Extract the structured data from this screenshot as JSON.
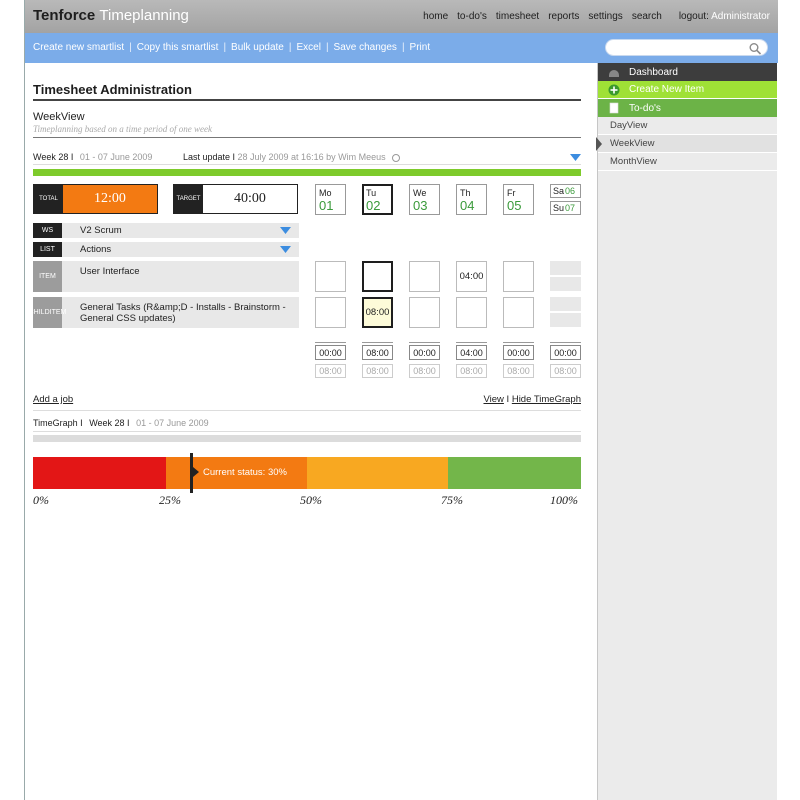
{
  "header": {
    "logo_part1": "Tenforce",
    "logo_part2": "Timeplanning",
    "nav": [
      "home",
      "to-do's",
      "timesheet",
      "reports",
      "settings",
      "search"
    ],
    "logout_label": "logout:",
    "user": "Administrator"
  },
  "toolbar": {
    "actions": [
      "Create new smartlist",
      "Copy this smartlist",
      "Bulk update",
      "Excel",
      "Save changes",
      "Print"
    ],
    "separator": "|",
    "search_placeholder": ""
  },
  "sidebar": {
    "dashboard": "Dashboard",
    "create_new_item": "Create New Item",
    "todos": "To-do's",
    "views": [
      "DayView",
      "WeekView",
      "MonthView"
    ],
    "active_view": "WeekView"
  },
  "page": {
    "title": "Timesheet Administration",
    "view_title": "WeekView",
    "view_subtitle": "Timeplanning based on a time period of one week",
    "week_label": "Week 28 I",
    "week_range": "01 - 07 June 2009",
    "last_update_label": "Last update I",
    "last_update_value": "28 July 2009 at 16:16 by Wim Meeus"
  },
  "totals": {
    "total_label": "TOTAL",
    "total_value": "12:00",
    "target_label": "TARGET",
    "target_value": "40:00"
  },
  "days": [
    {
      "name": "Mo",
      "date": "01"
    },
    {
      "name": "Tu",
      "date": "02"
    },
    {
      "name": "We",
      "date": "03"
    },
    {
      "name": "Th",
      "date": "04"
    },
    {
      "name": "Fr",
      "date": "05"
    }
  ],
  "weekend": [
    {
      "name": "Sa",
      "date": "06"
    },
    {
      "name": "Su",
      "date": "07"
    }
  ],
  "selectors": {
    "ws_tag": "WS",
    "ws_value": "V2 Scrum",
    "list_tag": "LIST",
    "list_value": "Actions"
  },
  "item": {
    "tag": "ITEM",
    "name": "User Interface",
    "hours": [
      "",
      "",
      "",
      "04:00",
      ""
    ]
  },
  "child_item": {
    "tag_line1": "CHILD",
    "tag_line2": "ITEM",
    "name": "General Tasks (R&amp;D - Installs - Brainstorm - General CSS updates)",
    "hours": [
      "",
      "08:00",
      "",
      "",
      ""
    ]
  },
  "summary": {
    "totals": [
      "00:00",
      "08:00",
      "00:00",
      "04:00",
      "00:00",
      "00:00"
    ],
    "targets": [
      "08:00",
      "08:00",
      "08:00",
      "08:00",
      "08:00",
      "08:00"
    ]
  },
  "actions": {
    "add_job": "Add a job",
    "view_label": "View",
    "separator": "I",
    "hide_timegraph": "Hide TimeGraph"
  },
  "timegraph": {
    "label": "TimeGraph I",
    "week": "Week 28 I",
    "range": "01 - 07 June 2009",
    "status_label": "Current status: 30%",
    "current_status_pct": 30,
    "ticks": [
      "0%",
      "25%",
      "50%",
      "75%",
      "100%"
    ],
    "colors": {
      "red": "#e31616",
      "orange": "#f37a12",
      "amber": "#f8a821",
      "green": "#73b64a"
    }
  },
  "colors": {
    "accent_blue": "#7bace9",
    "header_grey": "#a3a3a3",
    "total_orange": "#f37a12",
    "progress_green": "#7ecb2b",
    "date_green": "#3a9a3a"
  }
}
